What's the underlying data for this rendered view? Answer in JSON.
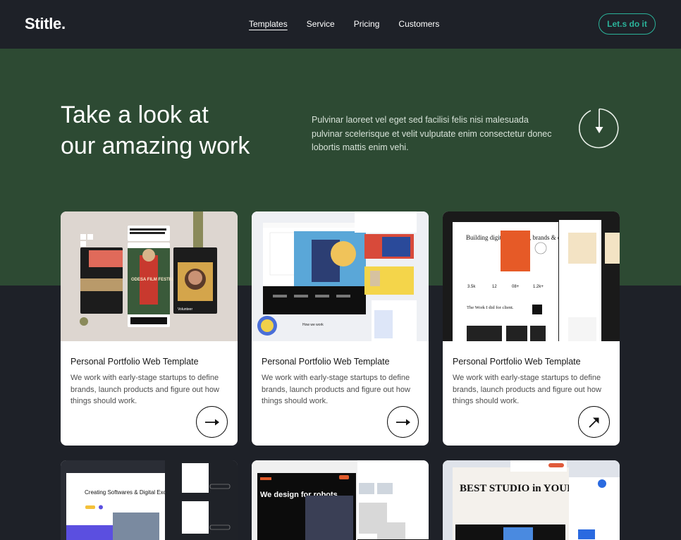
{
  "header": {
    "logo": "Stitle.",
    "nav": [
      {
        "label": "Templates",
        "active": true
      },
      {
        "label": "Service",
        "active": false
      },
      {
        "label": "Pricing",
        "active": false
      },
      {
        "label": "Customers",
        "active": false
      }
    ],
    "cta_label": "Let.s do it"
  },
  "hero": {
    "title_line1": "Take a look at",
    "title_line2": "our amazing work",
    "description": "Pulvinar laoreet vel eget sed facilisi felis nisi malesuada pulvinar scelerisque et velit vulputate enim consectetur donec lobortis mattis enim vehi.",
    "scroll_icon": "arrow-down-icon"
  },
  "cards": [
    {
      "title": "Personal Portfolio Web Template",
      "description": "We work with early-stage startups to define brands, launch products and figure out how things should work.",
      "icon": "arrow-right-icon",
      "thumb": {
        "card_texts": [
          "ODESA FILM FESTIVAL",
          "Volunteer"
        ]
      }
    },
    {
      "title": "Personal Portfolio Web Template",
      "description": "We work with early-stage startups to define brands, launch products and figure out how things should work.",
      "icon": "arrow-right-icon",
      "thumb": {
        "headline": "Add value on your brand to make your product closer to your consumers.",
        "section": "How we work"
      }
    },
    {
      "title": "Personal Portfolio Web Template",
      "description": "We work with early-stage startups to define brands, launch products and figure out how things should work.",
      "icon": "arrow-up-right-icon",
      "thumb": {
        "headline": "Building digital products, brands & expereince",
        "stats": [
          "3.5k",
          "12",
          "08+",
          "1.2k+"
        ],
        "sub": "The Work I did for client."
      }
    }
  ],
  "bottom_cards": [
    {
      "headline": "Creating Softwares & Digital Excellence"
    },
    {
      "headline": "We design for robots."
    },
    {
      "headline": "BEST STUDIO in YOUR TOWN"
    }
  ],
  "colors": {
    "background": "#1e2128",
    "hero": "#2d4a33",
    "accent": "#2bb39a",
    "card": "#ffffff"
  }
}
